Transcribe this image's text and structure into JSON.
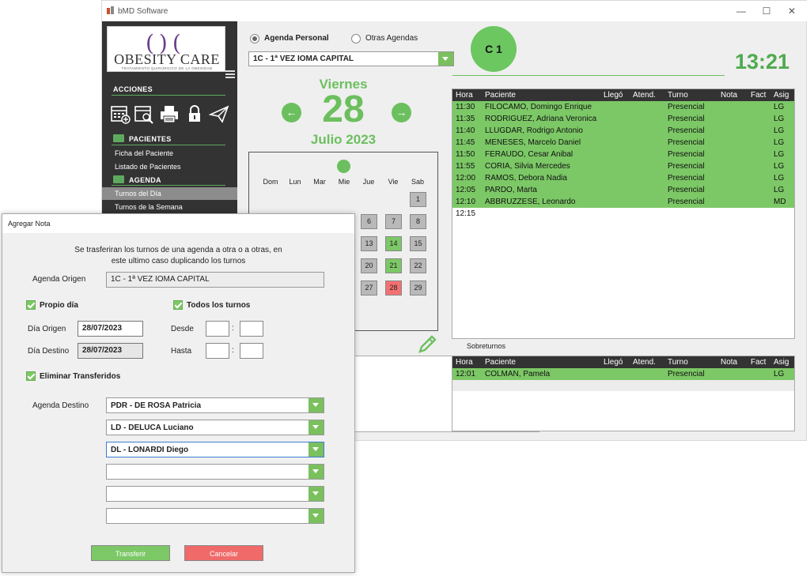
{
  "window": {
    "title": "bMD Software",
    "minimize": "—",
    "maximize": "☐",
    "close": "✕"
  },
  "sidebar": {
    "logo_main": "OBESITY CARE",
    "logo_sub": "TRATAMIENTO QUIRÚRGICO DE LA OBESIDAD",
    "acciones": "ACCIONES",
    "pacientes": "PACIENTES",
    "agenda": "AGENDA",
    "items": [
      "Ficha del Paciente",
      "Listado de Pacientes",
      "Turnos del Día",
      "Turnos de la Semana"
    ]
  },
  "top": {
    "radio_personal": "Agenda Personal",
    "radio_otras": "Otras Agendas",
    "agenda_select": "1C - 1ª VEZ IOMA CAPITAL",
    "badge": "C 1",
    "clock": "13:21"
  },
  "date": {
    "dow": "Viernes",
    "day": "28",
    "month": "Julio 2023"
  },
  "calendar": {
    "dows": [
      "Dom",
      "Lun",
      "Mar",
      "Mie",
      "Jue",
      "Vie",
      "Sab"
    ],
    "cells": [
      {
        "d": "1",
        "col": 6,
        "row": 0,
        "st": ""
      },
      {
        "d": "6",
        "col": 4,
        "row": 1,
        "st": ""
      },
      {
        "d": "7",
        "col": 5,
        "row": 1,
        "st": ""
      },
      {
        "d": "8",
        "col": 6,
        "row": 1,
        "st": ""
      },
      {
        "d": "13",
        "col": 4,
        "row": 2,
        "st": ""
      },
      {
        "d": "14",
        "col": 5,
        "row": 2,
        "st": "green"
      },
      {
        "d": "15",
        "col": 6,
        "row": 2,
        "st": ""
      },
      {
        "d": "20",
        "col": 4,
        "row": 3,
        "st": ""
      },
      {
        "d": "21",
        "col": 5,
        "row": 3,
        "st": "green"
      },
      {
        "d": "22",
        "col": 6,
        "row": 3,
        "st": ""
      },
      {
        "d": "27",
        "col": 4,
        "row": 4,
        "st": ""
      },
      {
        "d": "28",
        "col": 5,
        "row": 4,
        "st": "red"
      },
      {
        "d": "29",
        "col": 6,
        "row": 4,
        "st": ""
      }
    ]
  },
  "turnos": {
    "headers": [
      "Hora",
      "Paciente",
      "Llegó",
      "Atend.",
      "Turno",
      "Nota",
      "Fact",
      "Asig"
    ],
    "rows": [
      {
        "hora": "11:30",
        "paciente": "FILOCAMO, Domingo Enrique",
        "turno": "Presencial",
        "asig": "LG"
      },
      {
        "hora": "11:35",
        "paciente": "RODRIGUEZ, Adriana Veronica",
        "turno": "Presencial",
        "asig": "LG"
      },
      {
        "hora": "11:40",
        "paciente": "LLUGDAR, Rodrigo Antonio",
        "turno": "Presencial",
        "asig": "LG"
      },
      {
        "hora": "11:45",
        "paciente": "MENESES, Marcelo Daniel",
        "turno": "Presencial",
        "asig": "LG"
      },
      {
        "hora": "11:50",
        "paciente": "FERAUDO, Cesar Anibal",
        "turno": "Presencial",
        "asig": "LG"
      },
      {
        "hora": "11:55",
        "paciente": "CORIA, Silvia Mercedes",
        "turno": "Presencial",
        "asig": "LG"
      },
      {
        "hora": "12:00",
        "paciente": "RAMOS, Debora Nadia",
        "turno": "Presencial",
        "asig": "LG"
      },
      {
        "hora": "12:05",
        "paciente": "PARDO, Marta",
        "turno": "Presencial",
        "asig": "LG"
      },
      {
        "hora": "12:10",
        "paciente": "ABBRUZZESE, Leonardo",
        "turno": "Presencial",
        "asig": "MD"
      },
      {
        "hora": "12:15",
        "paciente": "",
        "turno": "",
        "asig": ""
      }
    ]
  },
  "sobreturnos": {
    "label": "Sobreturnos",
    "rows": [
      {
        "hora": "12:01",
        "paciente": "COLMAN, Pamela",
        "turno": "Presencial",
        "asig": "LG"
      }
    ]
  },
  "dialog": {
    "title": "Agregar Nota",
    "desc_line1": "Se trasferiran los turnos de una agenda a otra o a otras, en",
    "desc_line2": "este ultimo caso duplicando los turnos",
    "agenda_origen_label": "Agenda Origen",
    "agenda_origen_value": "1C - 1ª VEZ IOMA CAPITAL",
    "propio_dia": "Propio día",
    "todos_turnos": "Todos los turnos",
    "dia_origen_label": "Día Origen",
    "dia_origen_value": "28/07/2023",
    "dia_destino_label": "Día Destino",
    "dia_destino_value": "28/07/2023",
    "desde": "Desde",
    "hasta": "Hasta",
    "colon": ":",
    "eliminar": "Eliminar Transferidos",
    "agenda_destino_label": "Agenda Destino",
    "destinos": [
      "PDR - DE ROSA Patricia",
      "LD - DELUCA Luciano",
      "DL - LONARDI Diego",
      "",
      "",
      ""
    ],
    "btn_transferir": "Transferir",
    "btn_cancelar": "Cancelar"
  },
  "colors": {
    "accent": "#6cbf5e",
    "cancel": "#f06a6a",
    "row_green": "#7cc866"
  }
}
